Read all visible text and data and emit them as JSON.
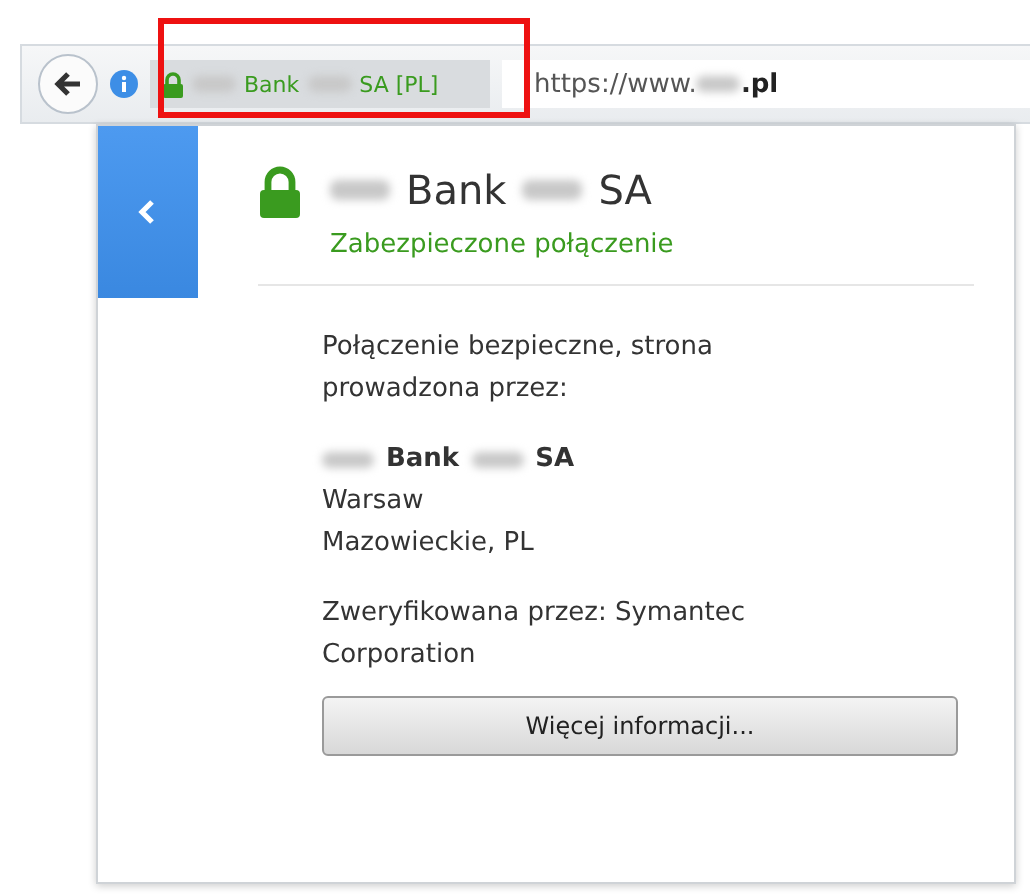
{
  "url_bar": {
    "identity_label": {
      "name": "Bank",
      "suffix": "SA [PL]"
    },
    "url_start": "https://www.",
    "url_end": ".pl"
  },
  "identity_popup": {
    "title": {
      "name": "Bank",
      "suffix": "SA"
    },
    "status": "Zabezpieczone połączenie",
    "intro": "Połączenie bezpieczne, strona prowadzona przez:",
    "owner": {
      "name": "Bank",
      "suffix": "SA"
    },
    "city": "Warsaw",
    "region": "Mazowieckie, PL",
    "verifier": "Zweryfikowana przez: Symantec Corporation",
    "button": "Więcej informacji..."
  }
}
